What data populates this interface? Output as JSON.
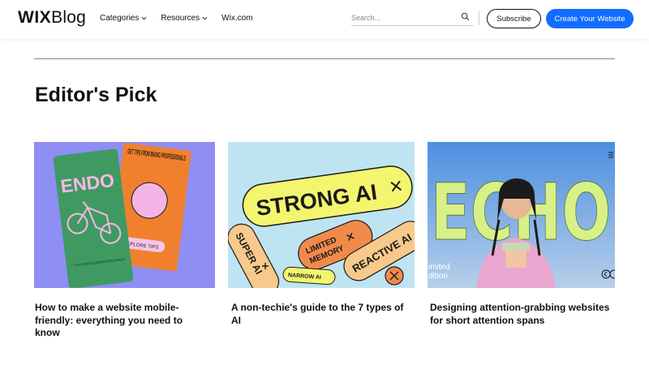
{
  "header": {
    "logo_bold": "WIX",
    "logo_light": "Blog",
    "nav": [
      {
        "label": "Categories",
        "has_dropdown": true
      },
      {
        "label": "Resources",
        "has_dropdown": true
      },
      {
        "label": "Wix.com",
        "has_dropdown": false
      }
    ],
    "search_placeholder": "Search...",
    "subscribe_label": "Subscribe",
    "create_label": "Create Your Website",
    "accent_color": "#116dff"
  },
  "section": {
    "title": "Editor's Pick"
  },
  "cards": [
    {
      "title": "How to make a website mobile-friendly: everything you need to know",
      "image": {
        "card1_text": "ENDO",
        "card1_small": "CITY BIKE PLATFORM FOR CYCLISTS BEGINNERS PROFESSIONALS INTERMEDIATES",
        "card2_text": "GET TIPS FROM BIKING PROFESSIONALS",
        "card2_button": "EXPLORE TIPS"
      }
    },
    {
      "title": "A non-techie's guide to the 7 types of AI",
      "image": {
        "pill_main": "STRONG AI",
        "pill_left": "SUPER AI",
        "pill_middle_line1": "LIMITED",
        "pill_middle_line2": "MEMORY",
        "pill_right": "REACTIVE AI",
        "pill_small": "NARROW AI"
      }
    },
    {
      "title": "Designing attention-grabbing websites for short attention spans",
      "image": {
        "big_word": "ECHO",
        "edge_text_line1": "imited",
        "edge_text_line2": "dition"
      }
    }
  ]
}
